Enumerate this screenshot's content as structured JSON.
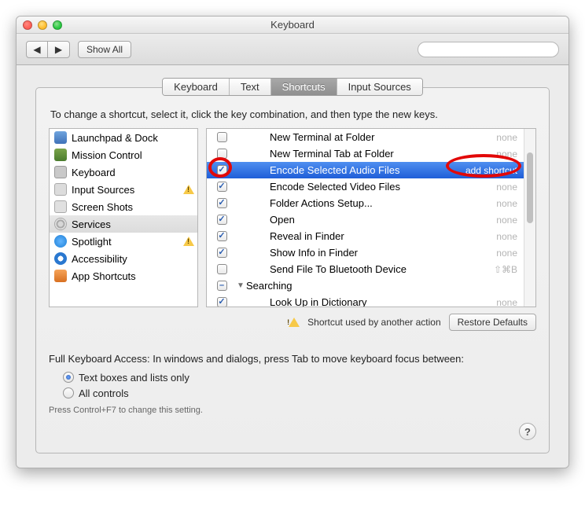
{
  "window": {
    "title": "Keyboard"
  },
  "toolbar": {
    "back": "◀",
    "forward": "▶",
    "show_all": "Show All",
    "search_placeholder": ""
  },
  "tabs": [
    {
      "label": "Keyboard",
      "active": false
    },
    {
      "label": "Text",
      "active": false
    },
    {
      "label": "Shortcuts",
      "active": true
    },
    {
      "label": "Input Sources",
      "active": false
    }
  ],
  "instruction": "To change a shortcut, select it, click the key combination, and then type the new keys.",
  "categories": [
    {
      "label": "Launchpad & Dock",
      "icon": "icn-launchpad",
      "warn": false
    },
    {
      "label": "Mission Control",
      "icon": "icn-mission",
      "warn": false
    },
    {
      "label": "Keyboard",
      "icon": "icn-keyboard",
      "warn": false
    },
    {
      "label": "Input Sources",
      "icon": "icn-input",
      "warn": true
    },
    {
      "label": "Screen Shots",
      "icon": "icn-screen",
      "warn": false
    },
    {
      "label": "Services",
      "icon": "icn-services",
      "warn": false,
      "selected": true
    },
    {
      "label": "Spotlight",
      "icon": "icn-spotlight",
      "warn": true
    },
    {
      "label": "Accessibility",
      "icon": "icn-access",
      "warn": false
    },
    {
      "label": "App Shortcuts",
      "icon": "icn-app",
      "warn": false
    }
  ],
  "services": [
    {
      "checked": false,
      "label": "New Terminal at Folder",
      "shortcut": "none",
      "indent": 1
    },
    {
      "checked": false,
      "label": "New Terminal Tab at Folder",
      "shortcut": "none",
      "indent": 1
    },
    {
      "checked": true,
      "label": "Encode Selected Audio Files",
      "shortcut": "add shortcut",
      "indent": 1,
      "selected": true
    },
    {
      "checked": true,
      "label": "Encode Selected Video Files",
      "shortcut": "none",
      "indent": 1
    },
    {
      "checked": true,
      "label": "Folder Actions Setup...",
      "shortcut": "none",
      "indent": 1
    },
    {
      "checked": true,
      "label": "Open",
      "shortcut": "none",
      "indent": 1
    },
    {
      "checked": true,
      "label": "Reveal in Finder",
      "shortcut": "none",
      "indent": 1
    },
    {
      "checked": true,
      "label": "Show Info in Finder",
      "shortcut": "none",
      "indent": 1
    },
    {
      "checked": false,
      "label": "Send File To Bluetooth Device",
      "shortcut": "⇧⌘B",
      "indent": 1
    },
    {
      "checked": "mixed",
      "label": "Searching",
      "shortcut": "",
      "indent": 0,
      "group": true
    },
    {
      "checked": true,
      "label": "Look Up in Dictionary",
      "shortcut": "none",
      "indent": 1
    }
  ],
  "conflict_note": "Shortcut used by another action",
  "restore_defaults": "Restore Defaults",
  "kbd_access": {
    "title": "Full Keyboard Access: In windows and dialogs, press Tab to move keyboard focus between:",
    "opt1": "Text boxes and lists only",
    "opt2": "All controls",
    "hint": "Press Control+F7 to change this setting."
  },
  "help": "?"
}
